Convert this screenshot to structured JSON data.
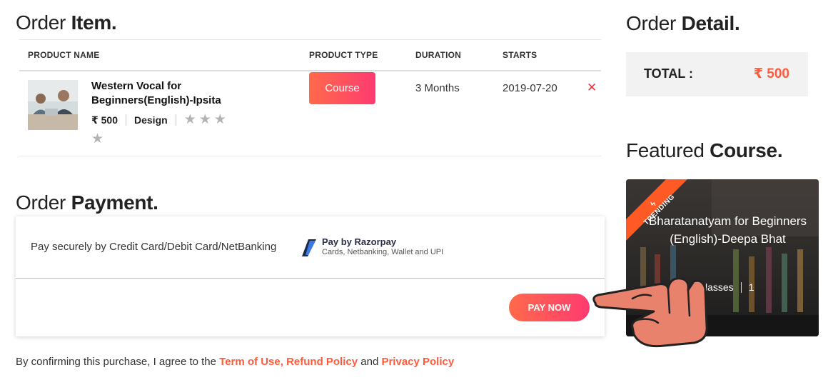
{
  "order_item": {
    "heading_light": "Order",
    "heading_bold": "Item.",
    "columns": {
      "product_name": "PRODUCT NAME",
      "product_type": "PRODUCT TYPE",
      "duration": "DURATION",
      "starts": "STARTS"
    },
    "rows": [
      {
        "name": "Western Vocal for Beginners(English)-Ipsita",
        "price": "₹ 500",
        "category": "Design",
        "rating": 0,
        "type": "Course",
        "duration": "3 Months",
        "starts": "2019-07-20",
        "remove_icon": "close-icon"
      }
    ]
  },
  "order_payment": {
    "heading_light": "Order",
    "heading_bold": "Payment.",
    "method_text": "Pay securely by Credit Card/Debit Card/NetBanking",
    "razorpay_title": "Pay by Razorpay",
    "razorpay_sub": "Cards, Netbanking, Wallet and UPI",
    "pay_button": "PAY NOW"
  },
  "agreement": {
    "prefix": "By confirming this purchase, I agree to the ",
    "terms_link": "Term of Use, Refund Policy",
    "middle": " and ",
    "privacy_link": "Privacy Policy"
  },
  "order_detail": {
    "heading_light": "Order",
    "heading_bold": "Detail.",
    "total_label": "TOTAL :",
    "total_value": "₹ 500"
  },
  "featured": {
    "heading_light": "Featured",
    "heading_bold": "Course.",
    "ribbon": "TRENDING",
    "title": "Bharatanatyam for Beginners (English)-Deepa Bhat",
    "classes_label": "classes",
    "count": "1"
  },
  "colors": {
    "accent": "#ff5a3c",
    "gradient_start": "#ff6a4b",
    "gradient_end": "#ff3b70",
    "remove": "#e8323c",
    "star_inactive": "#b4b4b4"
  }
}
